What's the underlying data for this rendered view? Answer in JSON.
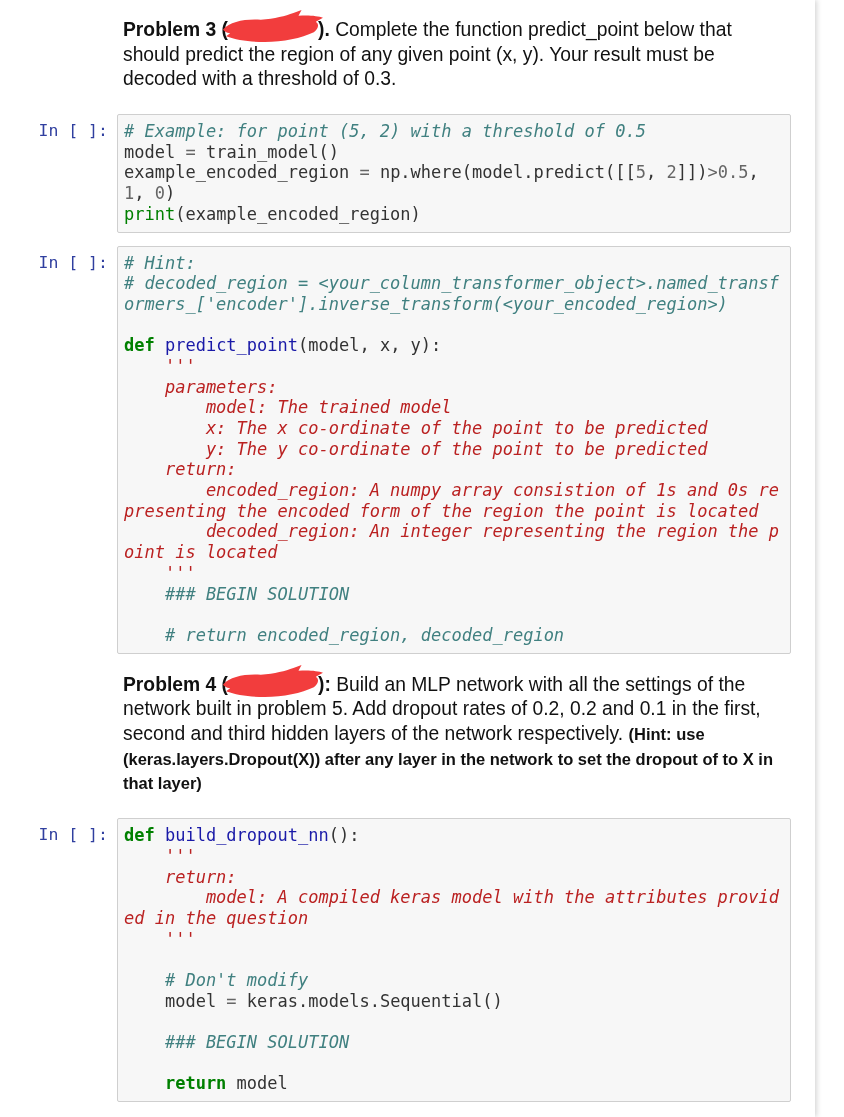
{
  "cells": [
    {
      "kind": "markdown",
      "paragraph": {
        "lead": "Problem 3 (",
        "redacted": true,
        "body": "**).** Complete the function predict_point below that should predict the region of any given point (x, y). Your result must be decoded with a threshold of 0.3."
      }
    },
    {
      "kind": "code",
      "prompt": "In [ ]:",
      "blocks": [
        {
          "lines": [
            {
              "segments": [
                {
                  "kind": "comment",
                  "text": "# Example: for point (5, 2) with a threshold of 0.5"
                }
              ]
            },
            {
              "segments": [
                {
                  "kind": "plain",
                  "text": "model "
                },
                {
                  "kind": "operator",
                  "text": "="
                },
                {
                  "kind": "plain",
                  "text": " train_model()"
                }
              ]
            },
            {
              "segments": [
                {
                  "kind": "plain",
                  "text": "example_encoded_region "
                },
                {
                  "kind": "operator",
                  "text": "="
                },
                {
                  "kind": "plain",
                  "text": " np.where(model.predict([["
                },
                {
                  "kind": "number",
                  "text": "5"
                },
                {
                  "kind": "plain",
                  "text": ", "
                },
                {
                  "kind": "number",
                  "text": "2"
                },
                {
                  "kind": "plain",
                  "text": "]])"
                },
                {
                  "kind": "operator",
                  "text": ">"
                },
                {
                  "kind": "number",
                  "text": "0.5"
                },
                {
                  "kind": "plain",
                  "text": ","
                }
              ]
            },
            {
              "segments": [
                {
                  "kind": "number",
                  "text": "1"
                },
                {
                  "kind": "plain",
                  "text": ", "
                },
                {
                  "kind": "number",
                  "text": "0"
                },
                {
                  "kind": "plain",
                  "text": ")"
                }
              ]
            },
            {
              "segments": [
                {
                  "kind": "builtin",
                  "text": "print"
                },
                {
                  "kind": "plain",
                  "text": "(example_encoded_region)"
                }
              ]
            }
          ]
        }
      ]
    },
    {
      "kind": "code",
      "prompt": "In [ ]:",
      "blocks": [
        {
          "lines": [
            {
              "segments": [
                {
                  "kind": "comment",
                  "text": "# Hint:"
                }
              ]
            },
            {
              "segments": [
                {
                  "kind": "comment",
                  "text": "# decoded_region = <your_column_transformer_object>.named_transf"
                }
              ]
            },
            {
              "segments": [
                {
                  "kind": "comment",
                  "text": "ormers_['encoder'].inverse_transform(<your_encoded_region>)"
                }
              ]
            }
          ]
        },
        {
          "lines": [
            {
              "segments": [
                {
                  "kind": "keyword",
                  "text": "def"
                },
                {
                  "kind": "def",
                  "text": " predict_point"
                },
                {
                  "kind": "plain",
                  "text": "(model, x, y):"
                }
              ]
            },
            {
              "segments": [
                {
                  "kind": "string",
                  "text": "    '''"
                }
              ]
            },
            {
              "segments": [
                {
                  "kind": "string",
                  "text": "    parameters:"
                }
              ]
            },
            {
              "segments": [
                {
                  "kind": "string",
                  "text": "        model: The trained model"
                }
              ]
            },
            {
              "segments": [
                {
                  "kind": "string",
                  "text": "        x: The x co-ordinate of the point to be predicted"
                }
              ]
            },
            {
              "segments": [
                {
                  "kind": "string",
                  "text": "        y: The y co-ordinate of the point to be predicted"
                }
              ]
            },
            {
              "segments": [
                {
                  "kind": "string",
                  "text": "    return:"
                }
              ]
            },
            {
              "segments": [
                {
                  "kind": "string",
                  "text": "        encoded_region: A numpy array consistion of 1s and 0s re"
                }
              ]
            },
            {
              "segments": [
                {
                  "kind": "string",
                  "text": "presenting the encoded form of the region the point is located"
                }
              ]
            },
            {
              "segments": [
                {
                  "kind": "string",
                  "text": "        decoded_region: An integer representing the region the p"
                }
              ]
            },
            {
              "segments": [
                {
                  "kind": "string",
                  "text": "oint is located"
                }
              ]
            },
            {
              "segments": [
                {
                  "kind": "string",
                  "text": "    '''"
                }
              ]
            },
            {
              "segments": [
                {
                  "kind": "comment",
                  "text": "    ### BEGIN SOLUTION"
                }
              ]
            }
          ]
        },
        {
          "lines": [
            {
              "segments": [
                {
                  "kind": "comment",
                  "text": "    # return encoded_region, decoded_region"
                }
              ]
            }
          ]
        }
      ]
    },
    {
      "kind": "markdown",
      "paragraph": {
        "lead": "Problem 4 (",
        "redacted": true,
        "body": "**):** Build an MLP network with all the settings of the network built in problem 5. Add dropout rates of 0.2, 0.2 and 0.1 in the first, second and third hidden layers of the network respectively.",
        "hint": "(Hint: use (keras.layers.Dropout(X)) after any layer in the network to set the dropout of to X in that layer)"
      }
    },
    {
      "kind": "code",
      "prompt": "In [ ]:",
      "blocks": [
        {
          "lines": [
            {
              "segments": [
                {
                  "kind": "keyword",
                  "text": "def"
                },
                {
                  "kind": "def",
                  "text": " build_dropout_nn"
                },
                {
                  "kind": "plain",
                  "text": "():"
                }
              ]
            },
            {
              "segments": [
                {
                  "kind": "string",
                  "text": "    '''"
                }
              ]
            },
            {
              "segments": [
                {
                  "kind": "string",
                  "text": "    return:"
                }
              ]
            },
            {
              "segments": [
                {
                  "kind": "string",
                  "text": "        model: A compiled keras model with the attributes provid"
                }
              ]
            },
            {
              "segments": [
                {
                  "kind": "string",
                  "text": "ed in the question"
                }
              ]
            },
            {
              "segments": [
                {
                  "kind": "string",
                  "text": "    '''"
                }
              ]
            }
          ]
        },
        {
          "lines": [
            {
              "segments": [
                {
                  "kind": "comment",
                  "text": "    # Don't modify"
                }
              ]
            },
            {
              "segments": [
                {
                  "kind": "plain",
                  "text": "    model "
                },
                {
                  "kind": "operator",
                  "text": "="
                },
                {
                  "kind": "plain",
                  "text": " keras.models.Sequential()"
                }
              ]
            }
          ]
        },
        {
          "lines": [
            {
              "segments": [
                {
                  "kind": "comment",
                  "text": "    ### BEGIN SOLUTION"
                }
              ]
            }
          ]
        },
        {
          "lines": [
            {
              "segments": [
                {
                  "kind": "keyword",
                  "text": "    return"
                },
                {
                  "kind": "plain",
                  "text": " model"
                }
              ]
            }
          ]
        }
      ]
    }
  ]
}
